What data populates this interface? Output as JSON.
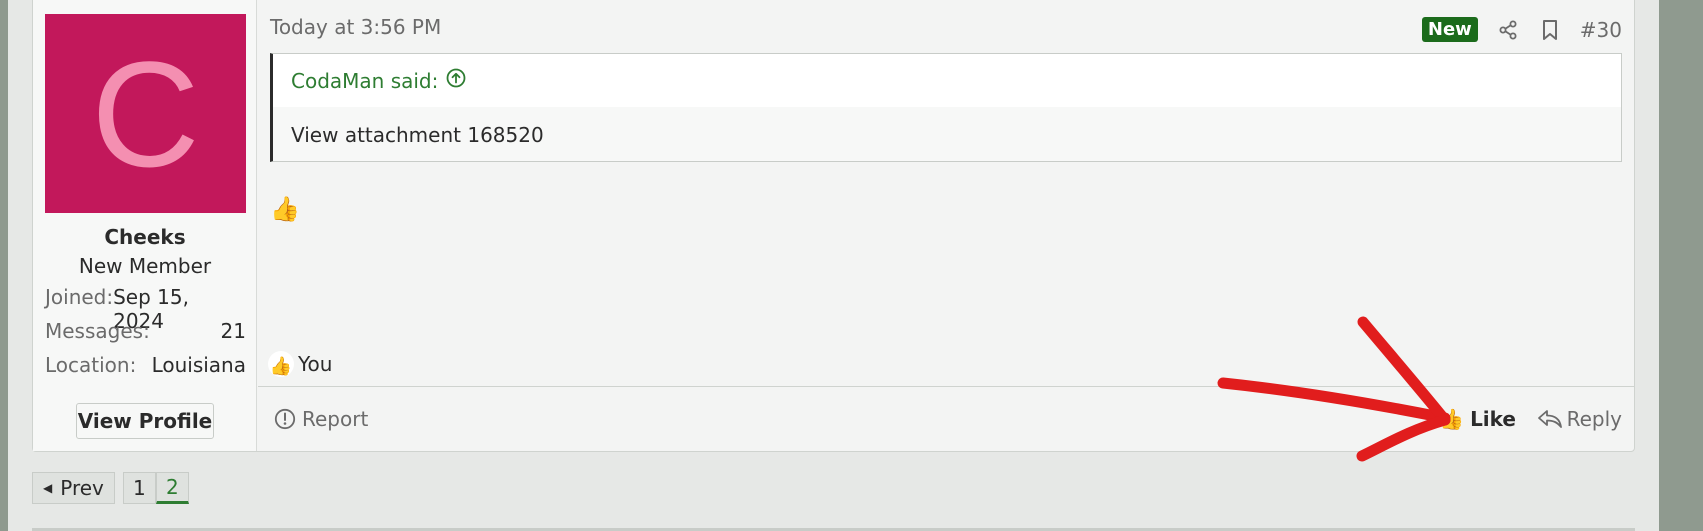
{
  "post": {
    "timestamp": "Today at 3:56 PM",
    "badge": "New",
    "post_number": "#30",
    "quote_author": "CodaMan said:",
    "quote_text": "View attachment 168520",
    "body_emoji": "👍",
    "reactions_label": "You",
    "reaction_emoji": "👍"
  },
  "user": {
    "avatar_letter": "C",
    "name": "Cheeks",
    "title": "New Member",
    "stats": [
      {
        "key": "Joined:",
        "value": "Sep 15, 2024"
      },
      {
        "key": "Messages:",
        "value": "21"
      },
      {
        "key": "Location:",
        "value": "Louisiana"
      }
    ],
    "view_profile": "View Profile"
  },
  "footer": {
    "report": "Report",
    "like": "Like",
    "like_emoji": "👍",
    "reply": "Reply"
  },
  "pagination": {
    "prev": "Prev",
    "pages": [
      "1",
      "2"
    ],
    "current": "2"
  },
  "colors": {
    "avatar_bg": "#c2185b",
    "avatar_letter": "#f48fb1",
    "badge_bg": "#1b6b1b",
    "annotation": "#e11d1d"
  }
}
